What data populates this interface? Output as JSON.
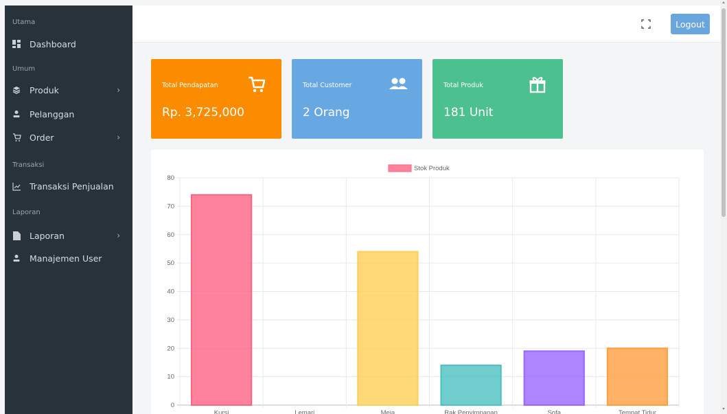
{
  "sidebar": {
    "sections": [
      {
        "label": "Utama"
      },
      {
        "label": "Umum"
      },
      {
        "label": "Transaksi"
      },
      {
        "label": "Laporan"
      }
    ],
    "items": [
      {
        "label": "Dashboard",
        "icon": "dashboard-icon"
      },
      {
        "label": "Produk",
        "icon": "layers-icon",
        "has_submenu": true
      },
      {
        "label": "Pelanggan",
        "icon": "user-icon"
      },
      {
        "label": "Order",
        "icon": "cart-icon",
        "has_submenu": true
      },
      {
        "label": "Transaksi Penjualan",
        "icon": "line-chart-icon"
      },
      {
        "label": "Laporan",
        "icon": "file-icon",
        "has_submenu": true
      },
      {
        "label": "Manajemen User",
        "icon": "user-icon"
      }
    ]
  },
  "topbar": {
    "fullscreen_icon": "fullscreen-icon",
    "logout_label": "Logout"
  },
  "cards": [
    {
      "title": "Total Pendapatan",
      "value": "Rp. 3,725,000",
      "icon": "cart-icon",
      "color": "#fb8c00"
    },
    {
      "title": "Total Customer",
      "value": "2 Orang",
      "icon": "users-icon",
      "color": "#68a8e2"
    },
    {
      "title": "Total Produk",
      "value": "181 Unit",
      "icon": "gift-icon",
      "color": "#4dc08f"
    }
  ],
  "chart_data": {
    "type": "bar",
    "categories": [
      "Kursi",
      "Lemari",
      "Meja",
      "Rak Penyimpanan",
      "Sofa",
      "Tempat Tidur"
    ],
    "series": [
      {
        "name": "Stok Produk",
        "values": [
          74,
          0,
          54,
          14,
          19,
          20
        ]
      }
    ],
    "colors": [
      "#ff6384",
      "#36a2eb",
      "#ffce56",
      "#4bc0c0",
      "#9966ff",
      "#ff9f40"
    ],
    "ylim": [
      0,
      80
    ],
    "yticks": [
      0,
      10,
      20,
      30,
      40,
      50,
      60,
      70,
      80
    ],
    "legend_position": "top-center",
    "grid": true
  }
}
